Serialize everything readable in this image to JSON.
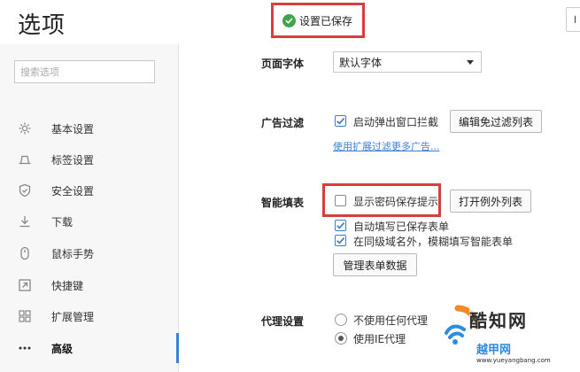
{
  "header": {
    "title": "选项",
    "saved_notice": "设置已保存",
    "edge_button": "I"
  },
  "sidebar": {
    "search_placeholder": "搜索选项",
    "items": [
      {
        "label": "基本设置",
        "icon": "gear-icon"
      },
      {
        "label": "标签设置",
        "icon": "tab-icon"
      },
      {
        "label": "安全设置",
        "icon": "shield-icon"
      },
      {
        "label": "下载",
        "icon": "download-icon"
      },
      {
        "label": "鼠标手势",
        "icon": "mouse-icon"
      },
      {
        "label": "快捷键",
        "icon": "shortcut-icon"
      },
      {
        "label": "扩展管理",
        "icon": "extensions-icon"
      },
      {
        "label": "高级",
        "icon": "more-icon",
        "active": true
      }
    ]
  },
  "main": {
    "font_section": {
      "label": "页面字体",
      "value": "默认字体"
    },
    "ad_section": {
      "label": "广告过滤",
      "popup_block_label": "启动弹出窗口拦截",
      "popup_block_checked": true,
      "edit_list_button": "编辑免过滤列表",
      "extension_link": "使用扩展过滤更多广告..."
    },
    "autofill_section": {
      "label": "智能填表",
      "show_password_prompt_label": "显示密码保存提示",
      "show_password_prompt_checked": false,
      "open_exceptions_button": "打开例外列表",
      "autofill_saved_label": "自动填写已保存表单",
      "autofill_saved_checked": true,
      "fuzzy_fill_label": "在同级域名外，模糊填写智能表单",
      "fuzzy_fill_checked": true,
      "manage_data_button": "管理表单数据"
    },
    "proxy_section": {
      "label": "代理设置",
      "option_1": "不使用任何代理",
      "option_2": "使用IE代理"
    }
  },
  "watermark": {
    "name": "酷知网",
    "url": "www.yueyangbang.com",
    "sub": "越甲网"
  },
  "colors": {
    "accent": "#3c7fd8",
    "highlight_red": "#d73f3f",
    "success_green": "#3fa54b"
  }
}
